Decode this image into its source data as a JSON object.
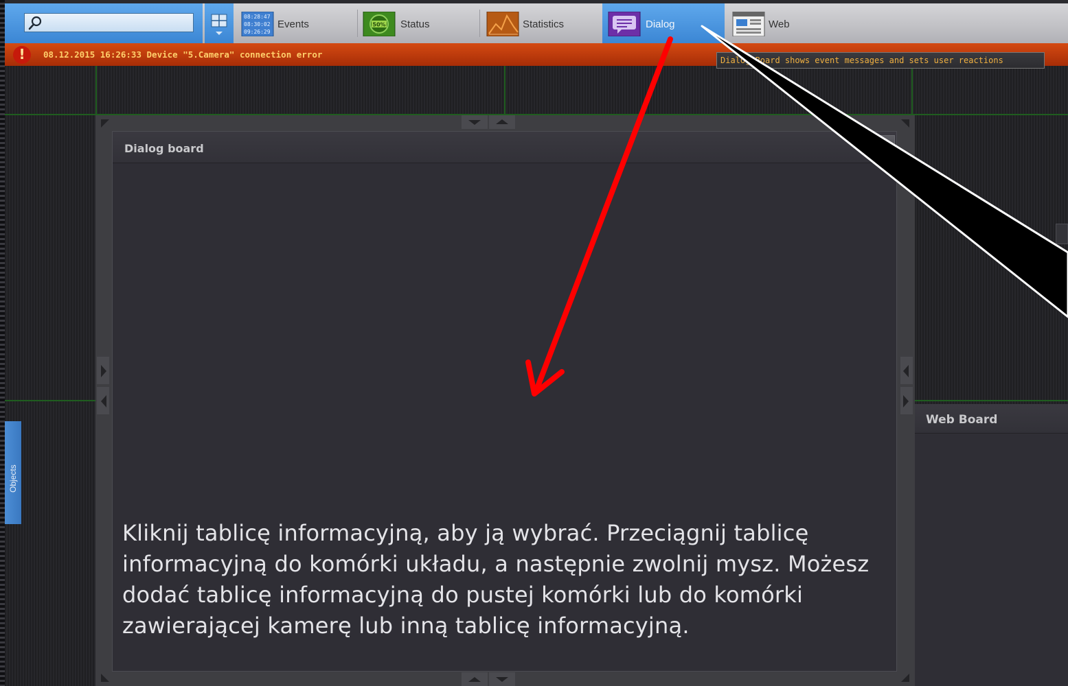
{
  "search": {
    "placeholder": "",
    "value": ""
  },
  "toolbar": {
    "items": [
      {
        "label": "Events",
        "icon": "events-clock-icon"
      },
      {
        "label": "Status",
        "icon": "status-50-icon"
      },
      {
        "label": "Statistics",
        "icon": "statistics-chart-icon"
      },
      {
        "label": "Dialog",
        "icon": "dialog-board-icon",
        "active": true
      },
      {
        "label": "Web",
        "icon": "web-board-icon"
      }
    ],
    "events_icon_times": [
      "08:28:47",
      "08:30:02",
      "09:26:29"
    ],
    "status_icon_text": "50%"
  },
  "alarm": {
    "icon": "!",
    "text": "08.12.2015 16:26:33 Device \"5.Camera\" connection error"
  },
  "tooltip": {
    "text": "Dialog Board shows event messages and sets user reactions"
  },
  "dialog_board": {
    "title": "Dialog board",
    "instructions": "Kliknij tablicę informacyjną, aby ją wybrać. Przeciągnij tablicę informacyjną do komórki układu, a następnie zwolnij mysz. Możesz dodać tablicę informacyjną do pustej komórki lub do komórki zawierającej kamerę lub inną tablicę informacyjną."
  },
  "web_board": {
    "title": "Web Board"
  },
  "side_tab": {
    "label": "Objects"
  },
  "colors": {
    "accent_blue": "#3b86d4",
    "alarm_red": "#a72d07",
    "alarm_text": "#ffcf6b",
    "grid_green": "#1f5d1f",
    "annotation_arrow": "#ff0000"
  }
}
